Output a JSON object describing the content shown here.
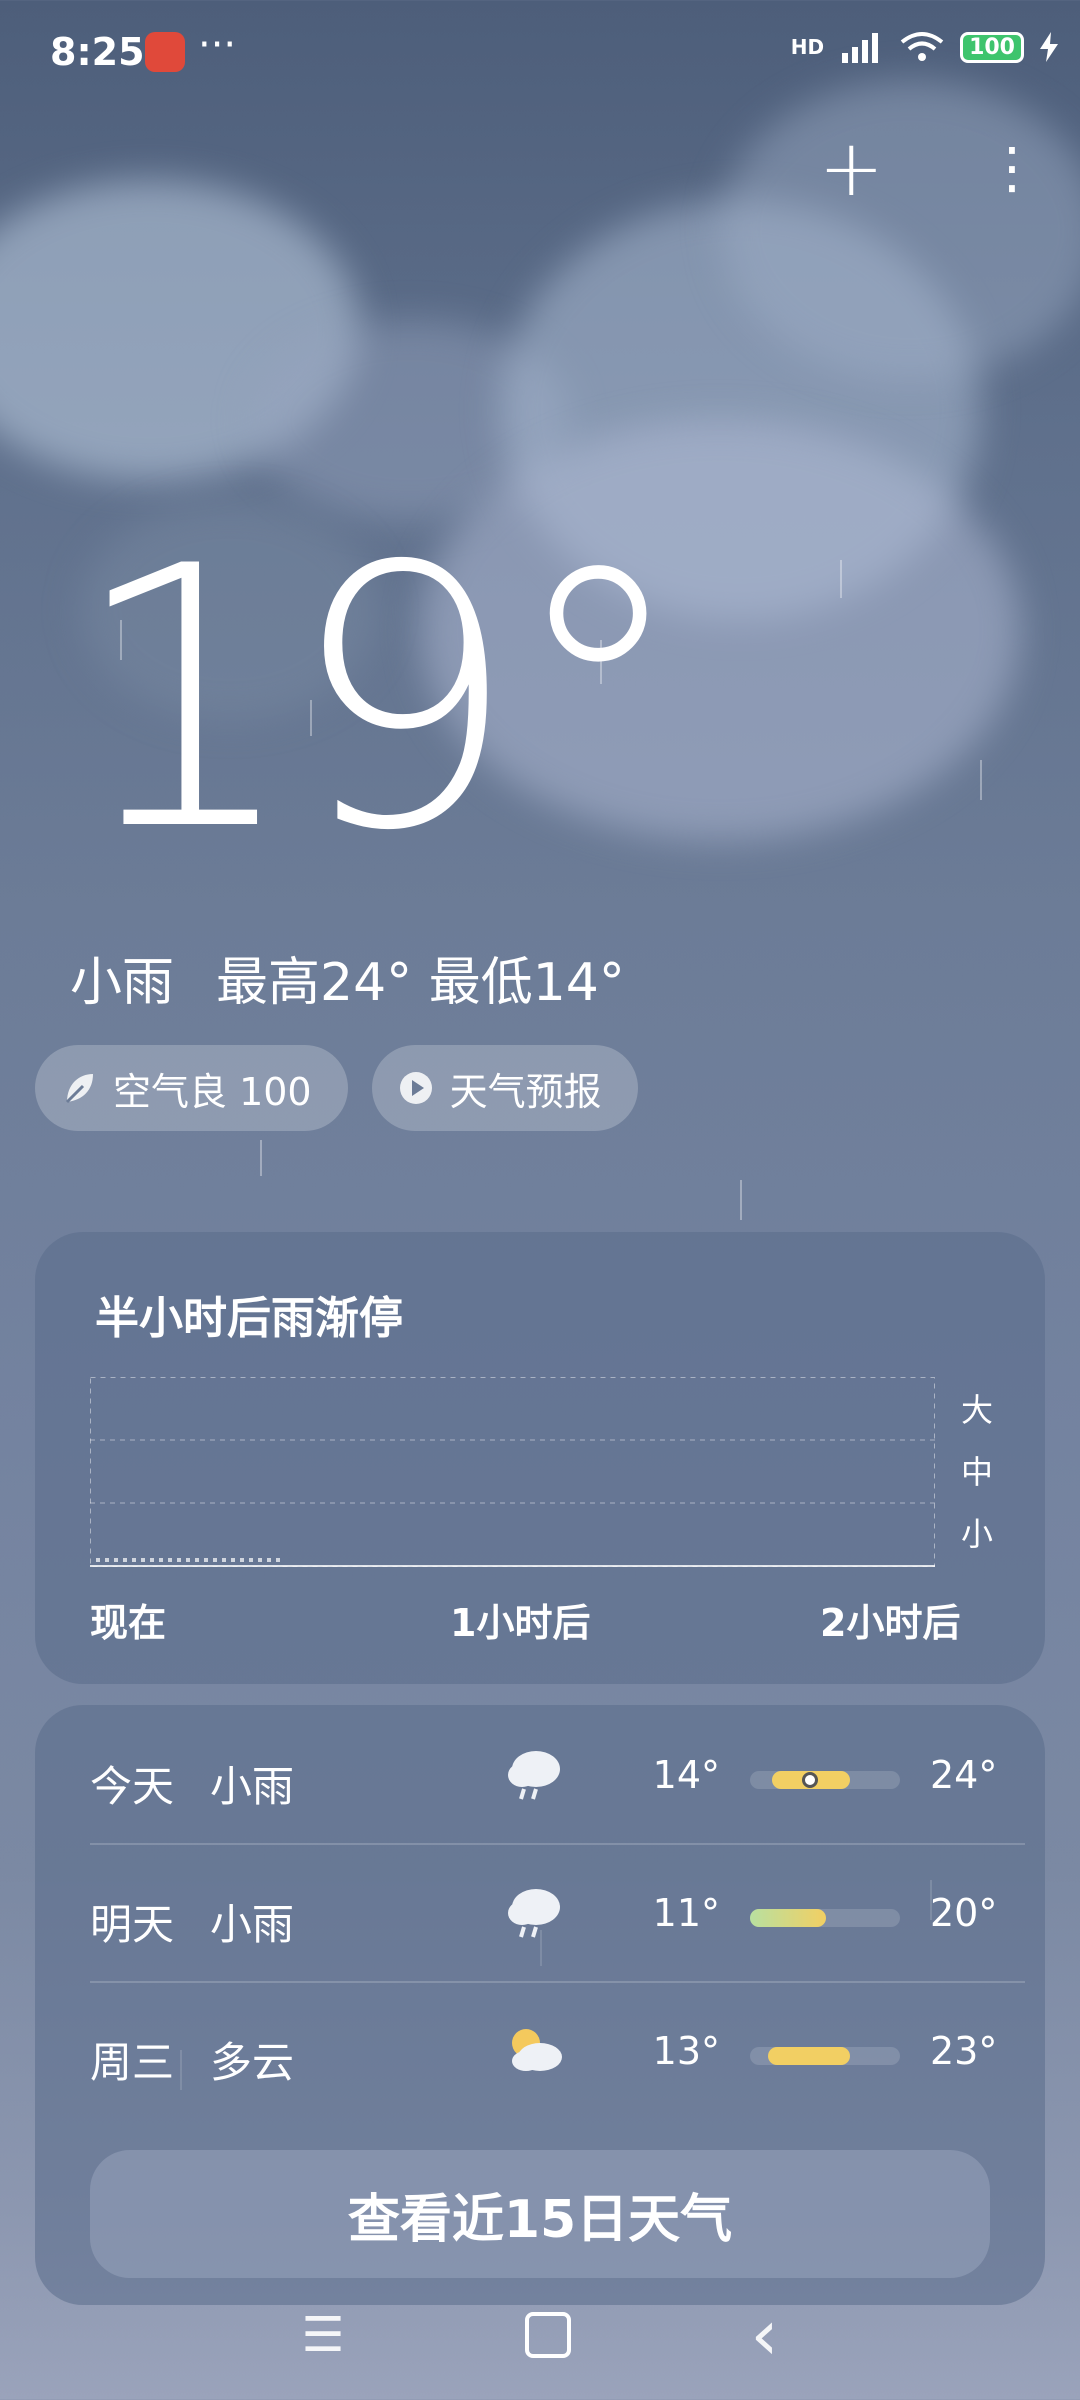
{
  "status_bar": {
    "time": "8:25",
    "dots": "···",
    "network": "HD",
    "battery": "100"
  },
  "top_actions": {
    "add_label": "+",
    "menu_label": "⋮"
  },
  "current": {
    "temperature": "19°",
    "condition": "小雨",
    "high": "最高24°",
    "low": "最低14°"
  },
  "chips": [
    {
      "label": "空气良 100"
    },
    {
      "label": "天气预报"
    }
  ],
  "rain_card": {
    "title": "半小时后雨渐停",
    "y_labels": [
      "大",
      "中",
      "小"
    ],
    "x_labels": [
      "现在",
      "1小时后",
      "2小时后"
    ]
  },
  "forecast": [
    {
      "day": "今天",
      "condition": "小雨",
      "icon": "rain-cloud-icon",
      "low": "14°",
      "high": "24°",
      "range": [
        0.15,
        0.65
      ],
      "current": 0.42
    },
    {
      "day": "明天",
      "condition": "小雨",
      "icon": "rain-cloud-icon",
      "low": "11°",
      "high": "20°",
      "range": [
        0.0,
        0.55
      ]
    },
    {
      "day": "周三",
      "condition": "多云",
      "icon": "partly-cloudy-icon",
      "low": "13°",
      "high": "23°",
      "range": [
        0.12,
        0.72
      ]
    }
  ],
  "button_15": "查看近15日天气",
  "nav": {
    "menu": "☰",
    "back": "‹"
  },
  "colors": {
    "accent_green": "#3ec46d",
    "bar_yellow": "#f2cf63",
    "bar_green": "#b8e0a0"
  }
}
